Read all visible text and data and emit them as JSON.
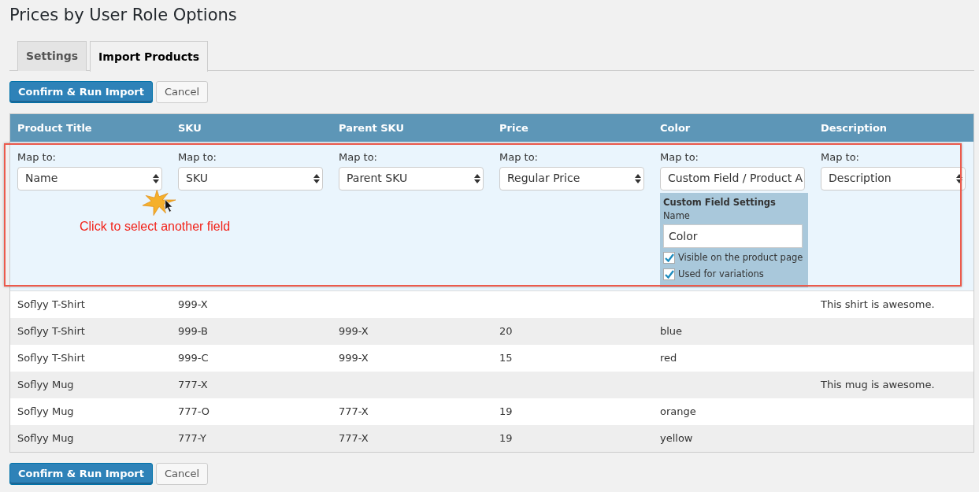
{
  "page_title": "Prices by User Role Options",
  "tabs": [
    {
      "label": "Settings",
      "selected": false
    },
    {
      "label": "Import Products",
      "selected": true
    }
  ],
  "top_buttons": [
    {
      "label": "Confirm & Run Import",
      "kind": "primary"
    },
    {
      "label": "Cancel",
      "kind": "secondary"
    }
  ],
  "table": {
    "columns": [
      "Product Title",
      "SKU",
      "Parent SKU",
      "Price",
      "Color",
      "Description"
    ],
    "mappings": [
      {
        "label": "Map to:",
        "value": "Name"
      },
      {
        "label": "Map to:",
        "value": "SKU"
      },
      {
        "label": "Map to:",
        "value": "Parent SKU"
      },
      {
        "label": "Map to:",
        "value": "Regular Price"
      },
      {
        "label": "Map to:",
        "value": "Custom Field / Product A",
        "custom_field_settings": {
          "title": "Custom Field Settings",
          "name_label": "Name",
          "name_value": "Color",
          "options": [
            {
              "label": "Visible on the product page",
              "checked": true
            },
            {
              "label": "Used for variations",
              "checked": true
            }
          ]
        }
      },
      {
        "label": "Map to:",
        "value": "Description"
      }
    ],
    "rows": [
      {
        "product_title": "Soflyy T-Shirt",
        "sku": "999-X",
        "description": "This shirt is awesome."
      },
      {
        "product_title": "Soflyy T-Shirt",
        "sku": "999-B",
        "parent_sku": "999-X",
        "price": "20",
        "color_name": "blue"
      },
      {
        "product_title": "Soflyy T-Shirt",
        "sku": "999-C",
        "parent_sku": "999-X",
        "price": "15",
        "color_name": "red"
      },
      {
        "product_title": "Soflyy Mug",
        "sku": "777-X",
        "description": "This mug is awesome."
      },
      {
        "product_title": "Soflyy Mug",
        "sku": "777-O",
        "parent_sku": "777-X",
        "price": "19",
        "color_name": "orange"
      },
      {
        "product_title": "Soflyy Mug",
        "sku": "777-Y",
        "parent_sku": "777-X",
        "price": "19",
        "color_name": "yellow"
      }
    ]
  },
  "annotation": {
    "text": "Click to select another field"
  },
  "bottom_buttons": [
    {
      "label": "Confirm & Run Import",
      "kind": "primary"
    },
    {
      "label": "Cancel",
      "kind": "secondary"
    }
  ]
}
